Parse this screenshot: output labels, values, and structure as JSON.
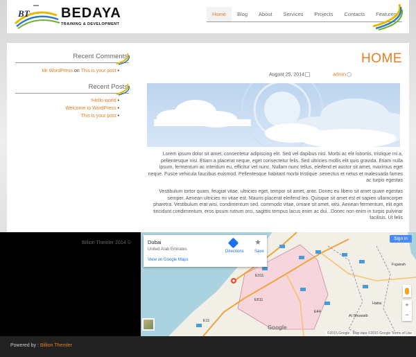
{
  "brand": {
    "initials": "BT",
    "name": "BEDAYA",
    "tagline": "TRAINING & DEVELOPMENT"
  },
  "nav": {
    "items": [
      {
        "label": "Home",
        "active": true
      },
      {
        "label": "Blog"
      },
      {
        "label": "About"
      },
      {
        "label": "Services"
      },
      {
        "label": "Projects"
      },
      {
        "label": "Contacts"
      },
      {
        "label": "Features"
      }
    ]
  },
  "sidebar": {
    "recent_comments": {
      "title": "Recent Comments",
      "author": "Mr WordPress",
      "on": "on",
      "post": "This is your post"
    },
    "recent_posts": {
      "title": "Recent Posts",
      "items": [
        "!Hello world",
        "Welcome to WordPress",
        "This is your post"
      ]
    }
  },
  "main": {
    "title": "HOME",
    "date": "August 25, 2014",
    "author": "admin",
    "paragraph_1": "Lorem ipsum dolor sit amet, consectetur adipiscing elit. Sed vel dapibus nisi. Morbi ac elit lobortis, tristique mi a, pellentesque nisi. Etiam a placerat neque, eget consectetur felis. Sed ultricies mollis elit quis gravida. Etiam nulla ipsum, fermentum ac interdum eu, efficitur vel nunc. Nullam nunc tellus, eleifend et auctor sit amet, maximus eget neque. Fusce vehicula faucibus euismod. Pellentesque habitant morbi tristique .senectus et netus et malesuada fames ac turpis egestas",
    "paragraph_2": "Vestibulum tortor quam, feugiat vitae, ultricies eget, tempor sit amet, ante. Donec eu libero sit amet quam egestas semper. Aenean ultricies mi vitae est. Mauris placerat eleifend leo. Quisque sit amet est et sapien ullamcorper pharetra. Vestibulum erat wisi, condimentum sed, commodo vitae, ornare sit amet, wisi. Aenean fermentum, elit eget tincidunt condimentum, eros ipsum rutrum orci, sagittis tempus lacus enim ac dui. .Donec non enim in turpis pulvinar facilisis. Ut felis"
  },
  "footer": {
    "copyright": "Billion Themler 2014 ©",
    "powered_by": "Powered by :",
    "powered_link": "Billion Themler"
  },
  "map": {
    "place": "Dubai",
    "country": "United Arab Emirates",
    "view_larger": "View on Google Maps",
    "directions": "Directions",
    "save": "Save",
    "signin": "Sign in",
    "zoom_in": "+",
    "zoom_out": "−",
    "google": "Google",
    "attribution": "©2015 Google · Map data ©2015 Google   Terms of Use",
    "labels": {
      "fujairah": "Fujairah",
      "al_shuwaib": "Al Shuwaib",
      "hatta": "Hatta",
      "e611": "E611",
      "e44": "E44",
      "e11": "E11",
      "e311": "E311"
    }
  },
  "colors": {
    "accent": "#e67e22",
    "header_bg": "#ffffff",
    "footer_bg": "#000000"
  }
}
